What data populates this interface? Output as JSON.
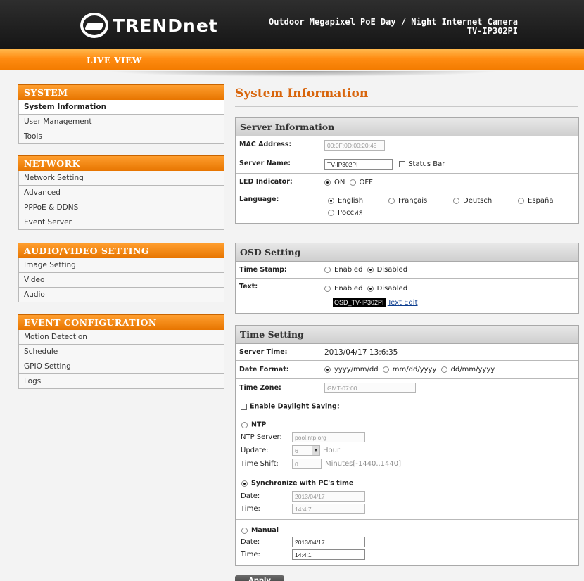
{
  "header": {
    "logo_text": "TRENDnet",
    "title_line1": "Outdoor Megapixel PoE Day / Night Internet Camera",
    "title_line2": "TV-IP302PI"
  },
  "nav": {
    "live_view": "LIVE VIEW"
  },
  "sidebar": {
    "system": {
      "title": "SYSTEM",
      "items": [
        "System Information",
        "User Management",
        "Tools"
      ]
    },
    "network": {
      "title": "NETWORK",
      "items": [
        "Network Setting",
        "Advanced",
        "PPPoE & DDNS",
        "Event Server"
      ]
    },
    "av": {
      "title": "AUDIO/VIDEO SETTING",
      "items": [
        "Image Setting",
        "Video",
        "Audio"
      ]
    },
    "event": {
      "title": "EVENT CONFIGURATION",
      "items": [
        "Motion Detection",
        "Schedule",
        "GPIO Setting",
        "Logs"
      ]
    }
  },
  "page_title": "System Information",
  "server": {
    "title": "Server Information",
    "mac_label": "MAC Address:",
    "mac_value": "00:0F:0D:00:20:45",
    "name_label": "Server Name:",
    "name_value": "TV-IP302PI",
    "status_bar_label": "Status Bar",
    "led_label": "LED Indicator:",
    "led_on": "ON",
    "led_off": "OFF",
    "lang_label": "Language:",
    "lang_options": [
      "English",
      "Français",
      "Deutsch",
      "España",
      "Россия"
    ]
  },
  "osd": {
    "title": "OSD Setting",
    "timestamp_label": "Time Stamp:",
    "text_label": "Text:",
    "enabled": "Enabled",
    "disabled": "Disabled",
    "osd_text": "OSD_TV-IP302PI",
    "text_edit": "Text Edit"
  },
  "time": {
    "title": "Time Setting",
    "server_time_label": "Server Time:",
    "server_time_value": "2013/04/17 13:6:35",
    "date_format_label": "Date Format:",
    "date_formats": [
      "yyyy/mm/dd",
      "mm/dd/yyyy",
      "dd/mm/yyyy"
    ],
    "timezone_label": "Time Zone:",
    "timezone_value": "GMT-07:00",
    "daylight_label": "Enable Daylight Saving:",
    "ntp": {
      "label": "NTP",
      "server_label": "NTP Server:",
      "server_value": "pool.ntp.org",
      "update_label": "Update:",
      "update_value": "6",
      "update_unit": "Hour",
      "shift_label": "Time Shift:",
      "shift_value": "0",
      "shift_unit": "Minutes[-1440..1440]"
    },
    "sync": {
      "label": "Synchronize with PC's time",
      "date_label": "Date:",
      "date_value": "2013/04/17",
      "time_label": "Time:",
      "time_value": "14:4:7"
    },
    "manual": {
      "label": "Manual",
      "date_label": "Date:",
      "date_value": "2013/04/17",
      "time_label": "Time:",
      "time_value": "14:4:1"
    }
  },
  "apply_label": "Apply",
  "colors": {
    "orange": "#f37c00",
    "title_orange": "#d8650c",
    "header_dark": "#1f1f1f"
  }
}
